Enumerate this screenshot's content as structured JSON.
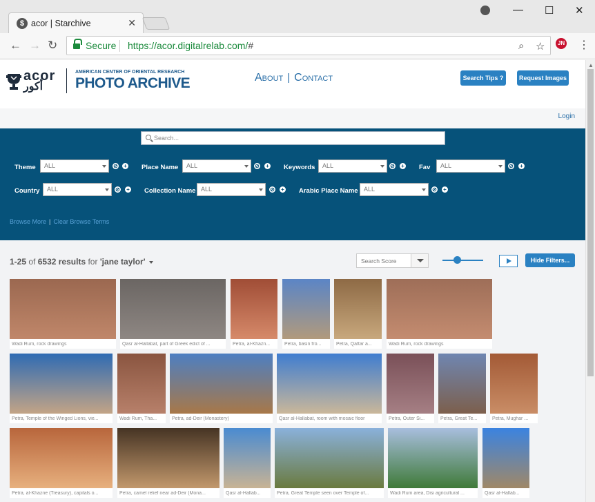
{
  "browser": {
    "tab_title": "acor | Starchive",
    "secure_label": "Secure",
    "url_domain": "https://acor.digitalrelab.com/",
    "url_rest": "#"
  },
  "header": {
    "logo_acor": "acor",
    "logo_arabic": "أكور",
    "logo_sub": "AMERICAN CENTER OF ORIENTAL RESEARCH",
    "logo_title": "PHOTO ARCHIVE",
    "nav_about": "About",
    "nav_sep": "|",
    "nav_contact": "Contact",
    "search_tips": "Search Tips ?",
    "request_images": "Request Images",
    "login": "Login"
  },
  "filters": {
    "search_placeholder": "Search...",
    "theme": {
      "label": "Theme",
      "value": "ALL"
    },
    "place_name": {
      "label": "Place Name",
      "value": "ALL"
    },
    "keywords": {
      "label": "Keywords",
      "value": "ALL"
    },
    "fav": {
      "label": "Fav",
      "value": "ALL"
    },
    "country": {
      "label": "Country",
      "value": "ALL"
    },
    "collection_name": {
      "label": "Collection Name",
      "value": "ALL"
    },
    "arabic_place_name": {
      "label": "Arabic Place Name",
      "value": "ALL"
    },
    "browse_more": "Browse More",
    "browse_sep": "|",
    "clear_browse": "Clear Browse Terms"
  },
  "results": {
    "range": "1-25",
    "of": "of",
    "total": "6532 results",
    "for": "for",
    "query": "'jane taylor'",
    "sort_placeholder": "Search Score",
    "slider_level": 0.35,
    "hide_filters": "Hide Filters..."
  },
  "thumbnails": [
    {
      "caption": "Wadi Rum, rock drawings",
      "colors": [
        "#9b6850",
        "#c0876a"
      ]
    },
    {
      "caption": "Qasr al-Hallabat, part of Greek edict of ...",
      "colors": [
        "#6b6663",
        "#8e8783"
      ]
    },
    {
      "caption": "Petra, al-Khazn...",
      "colors": [
        "#a04d36",
        "#d68a6a"
      ]
    },
    {
      "caption": "Petra, basin fro...",
      "colors": [
        "#5b85c6",
        "#b19a7c"
      ]
    },
    {
      "caption": "Petra, Qattar a...",
      "colors": [
        "#8e6a45",
        "#c8a87d"
      ]
    },
    {
      "caption": "Wadi Rum, rock drawings",
      "colors": [
        "#9e6e58",
        "#c48c70"
      ]
    },
    {
      "caption": "Petra, Temple of the Winged Lions, vie...",
      "colors": [
        "#2f6bb3",
        "#c3a486"
      ]
    },
    {
      "caption": "Wadi Rum, Tha...",
      "colors": [
        "#8a5540",
        "#b7806a"
      ]
    },
    {
      "caption": "Petra, ad-Deir (Monastery)",
      "colors": [
        "#4d7fc2",
        "#a87848"
      ]
    },
    {
      "caption": "Qasr al-Hallabat, room with mosaic floor",
      "colors": [
        "#3f7dd0",
        "#cab79a"
      ]
    },
    {
      "caption": "Petra, Outer Si...",
      "colors": [
        "#7a5058",
        "#a57f84"
      ]
    },
    {
      "caption": "Petra, Great Te...",
      "colors": [
        "#6f86b1",
        "#7c5f4c"
      ]
    },
    {
      "caption": "Petra, Mughar ...",
      "colors": [
        "#a35a36",
        "#c98d66"
      ]
    },
    {
      "caption": "Petra, al-Khazne (Treasury), capitals o...",
      "colors": [
        "#b8663c",
        "#e7b07e"
      ]
    },
    {
      "caption": "Petra, camel relief near ad-Deir (Mona...",
      "colors": [
        "#463424",
        "#c2986c"
      ]
    },
    {
      "caption": "Qasr al-Hallab...",
      "colors": [
        "#4a8bd1",
        "#c8b394"
      ]
    },
    {
      "caption": "Petra, Great Temple seen over Temple of...",
      "colors": [
        "#8ab1db",
        "#6a7a3e"
      ]
    },
    {
      "caption": "Wadi Rum area, Disi agricultural ...",
      "colors": [
        "#a8bede",
        "#3f7a38"
      ]
    },
    {
      "caption": "Qasr al-Hallab...",
      "colors": [
        "#3b83e0",
        "#a08867"
      ]
    }
  ]
}
